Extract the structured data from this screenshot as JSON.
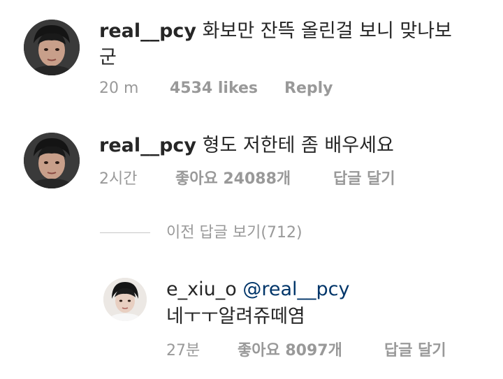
{
  "comments": [
    {
      "username": "real__pcy",
      "text_line1": "화보만 잔뜩 올린걸 보니 맞나보",
      "text_line2": "군",
      "time": "20 m",
      "likes": "4534 likes",
      "reply": "Reply"
    },
    {
      "username": "real__pcy",
      "text": "형도 저한테 좀 배우세요",
      "time": "2시간",
      "likes": "좋아요 24088개",
      "reply": "답글 달기"
    }
  ],
  "view_previous_replies": "이전 답글 보기(712)",
  "reply": {
    "username": "e_xiu_o",
    "mention": "@real__pcy",
    "text": "네ㅜㅜ알려쥬떼염",
    "time": "27분",
    "likes": "좋아요 8097개",
    "reply": "답글 달기"
  },
  "colors": {
    "text": "#262626",
    "meta": "#999999",
    "mention": "#003569",
    "divider": "#c7c7c7"
  }
}
